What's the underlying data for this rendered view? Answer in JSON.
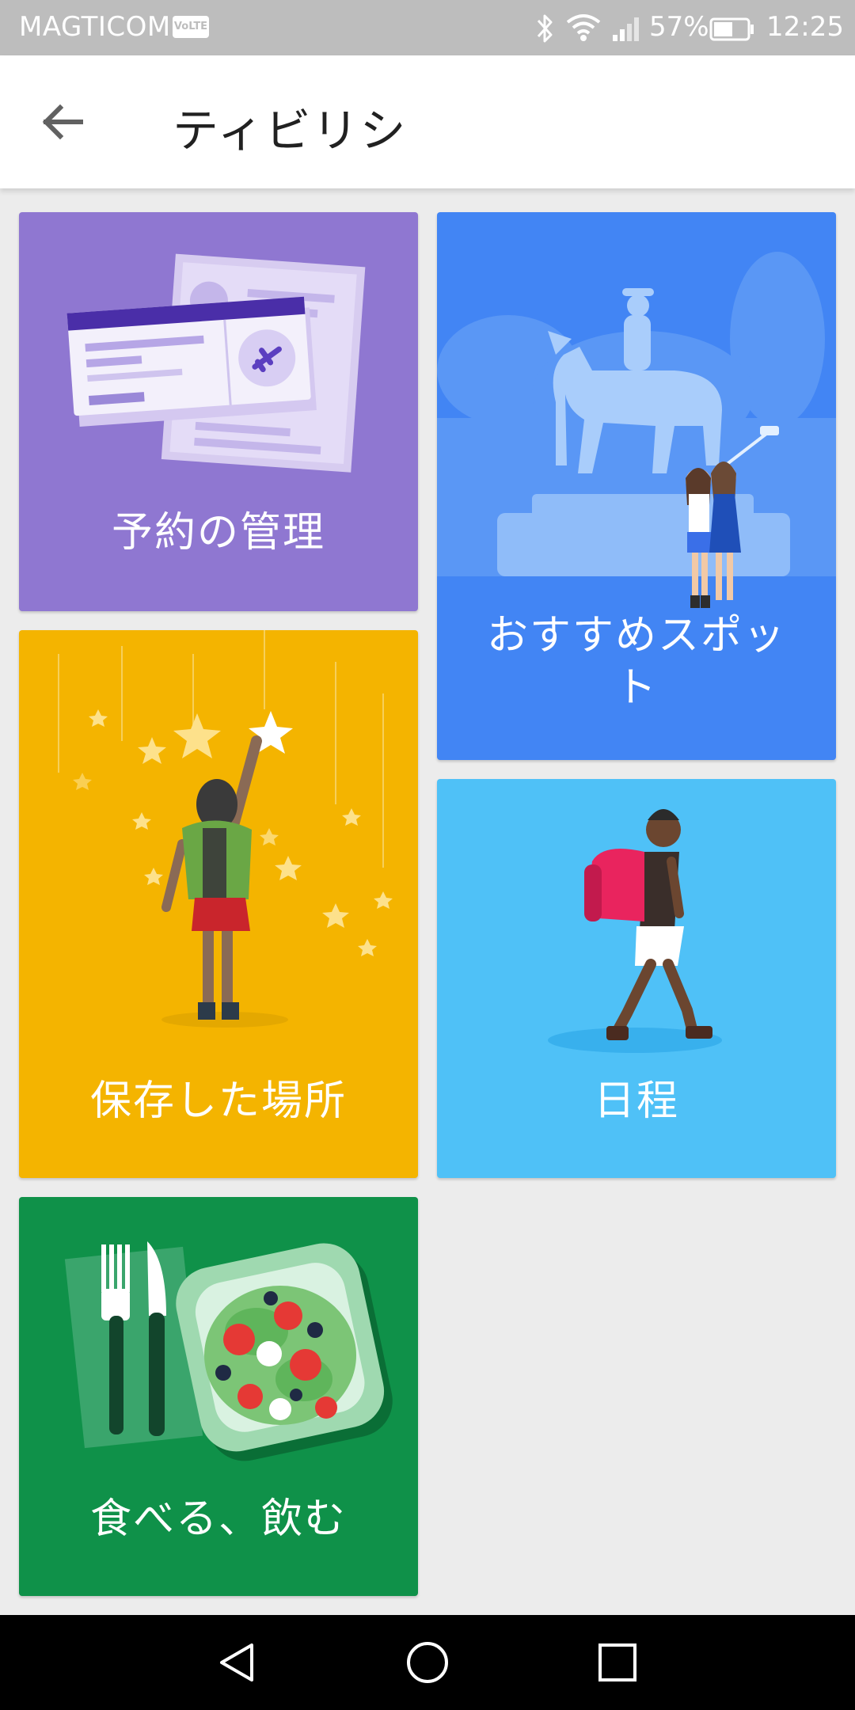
{
  "status_bar": {
    "carrier": "MAGTICOM",
    "volte_badge": "VoLTE",
    "battery_percent": "57%",
    "battery_level": 0.57,
    "time": "12:25"
  },
  "app_bar": {
    "title": "ティビリシ",
    "back_icon": "arrow-back-icon"
  },
  "cards": {
    "bookings": {
      "label": "予約の管理",
      "color": "#8f77d1"
    },
    "spots": {
      "label": "おすすめスポット",
      "color": "#4285f4"
    },
    "saved": {
      "label": "保存した場所",
      "color": "#f4b400"
    },
    "plans": {
      "label": "日程",
      "color": "#4fc1f7"
    },
    "eat": {
      "label": "食べる、飲む",
      "color": "#0f9149"
    }
  },
  "nav_bar": {
    "back_icon": "nav-back-triangle-icon",
    "home_icon": "nav-home-circle-icon",
    "recents_icon": "nav-recents-square-icon"
  }
}
